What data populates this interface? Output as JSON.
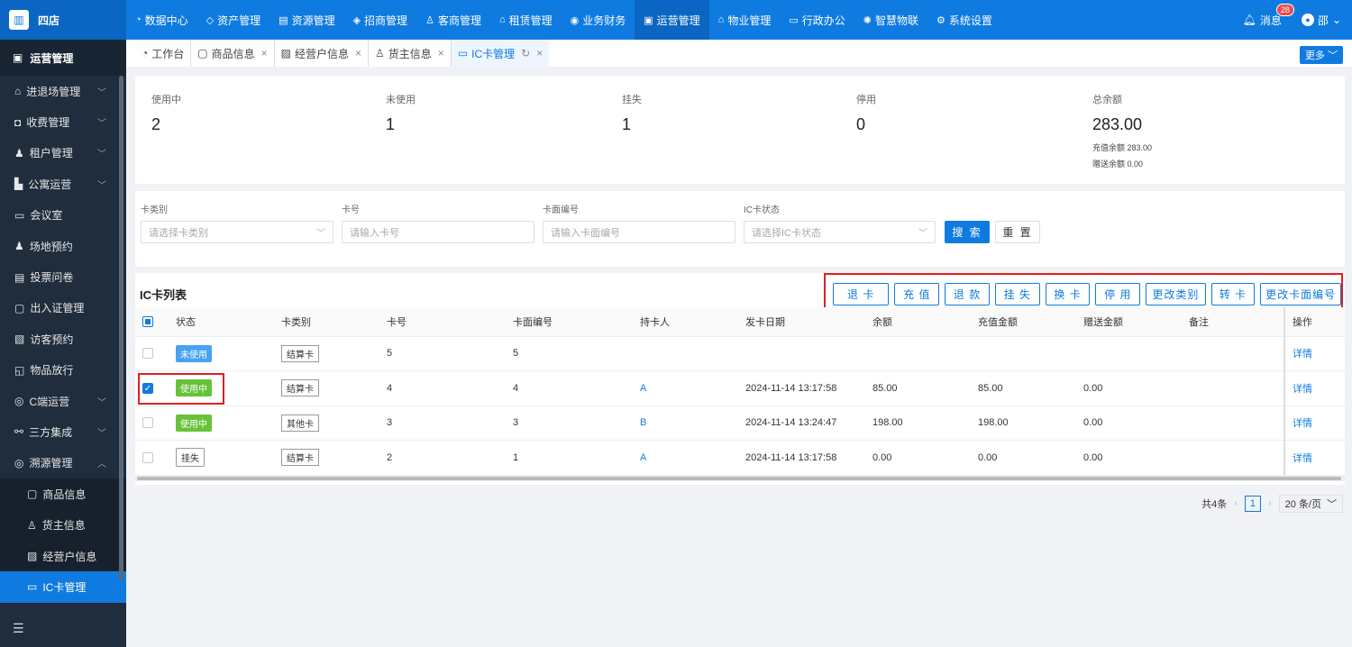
{
  "brand": {
    "logo_icon": "building-icon",
    "name": "四店"
  },
  "topnav": [
    {
      "label": "数据中心",
      "icon": "◔"
    },
    {
      "label": "资产管理",
      "icon": "◇"
    },
    {
      "label": "资源管理",
      "icon": "▤"
    },
    {
      "label": "招商管理",
      "icon": "◈"
    },
    {
      "label": "客商管理",
      "icon": "♙"
    },
    {
      "label": "租赁管理",
      "icon": "⌂"
    },
    {
      "label": "业务财务",
      "icon": "◉"
    },
    {
      "label": "运营管理",
      "icon": "▣"
    },
    {
      "label": "物业管理",
      "icon": "⌂"
    },
    {
      "label": "行政办公",
      "icon": "▭"
    },
    {
      "label": "智慧物联",
      "icon": "✺"
    },
    {
      "label": "系统设置",
      "icon": "⚙"
    }
  ],
  "top_right": {
    "message_label": "消息",
    "message_count": "28",
    "user_name": "邵"
  },
  "sidebar": {
    "header": "运营管理",
    "items": [
      {
        "label": "进退场管理",
        "icon": "⌂",
        "chev": "﹀"
      },
      {
        "label": "收费管理",
        "icon": "◘",
        "chev": "﹀"
      },
      {
        "label": "租户管理",
        "icon": "♟",
        "chev": "﹀"
      },
      {
        "label": "公寓运营",
        "icon": "▙",
        "chev": "﹀"
      },
      {
        "label": "会议室",
        "icon": "▭",
        "chev": ""
      },
      {
        "label": "场地预约",
        "icon": "♟",
        "chev": ""
      },
      {
        "label": "投票问卷",
        "icon": "▤",
        "chev": ""
      },
      {
        "label": "出入证管理",
        "icon": "▢",
        "chev": ""
      },
      {
        "label": "访客预约",
        "icon": "▧",
        "chev": ""
      },
      {
        "label": "物品放行",
        "icon": "◱",
        "chev": ""
      },
      {
        "label": "C端运营",
        "icon": "◎",
        "chev": "﹀"
      },
      {
        "label": "三方集成",
        "icon": "⚯",
        "chev": "﹀"
      },
      {
        "label": "溯源管理",
        "icon": "◎",
        "chev": "︿"
      }
    ],
    "sub_items": [
      {
        "label": "商品信息",
        "icon": "▢"
      },
      {
        "label": "货主信息",
        "icon": "♙"
      },
      {
        "label": "经营户信息",
        "icon": "▨"
      },
      {
        "label": "IC卡管理",
        "icon": "▭"
      }
    ],
    "collapse_icon": "☰"
  },
  "tabs": [
    {
      "label": "工作台",
      "icon": "◔"
    },
    {
      "label": "商品信息",
      "icon": "▢"
    },
    {
      "label": "经营户信息",
      "icon": "▨"
    },
    {
      "label": "货主信息",
      "icon": "♙"
    },
    {
      "label": "IC卡管理",
      "icon": "▭"
    }
  ],
  "more_label": "更多 ﹀",
  "stats": {
    "in_use": {
      "label": "使用中",
      "value": "2"
    },
    "unused": {
      "label": "未使用",
      "value": "1"
    },
    "lost": {
      "label": "挂失",
      "value": "1"
    },
    "disabled": {
      "label": "停用",
      "value": "0"
    },
    "total": {
      "label": "总余额",
      "value": "283.00",
      "recharge": "充值余额 283.00",
      "gift": "赠送余额 0.00"
    }
  },
  "filter": {
    "card_type": {
      "label": "卡类别",
      "placeholder": "请选择卡类别"
    },
    "card_no": {
      "label": "卡号",
      "placeholder": "请输入卡号"
    },
    "face_no": {
      "label": "卡面编号",
      "placeholder": "请输入卡面编号"
    },
    "status": {
      "label": "IC卡状态",
      "placeholder": "请选择IC卡状态"
    },
    "search": "搜 索",
    "reset": "重 置"
  },
  "list": {
    "title": "IC卡列表",
    "actions": [
      "退 卡",
      "充 值",
      "退 款",
      "挂 失",
      "换 卡",
      "停 用",
      "更改类别",
      "转 卡",
      "更改卡面编号"
    ],
    "columns": [
      "状态",
      "卡类别",
      "卡号",
      "卡面编号",
      "持卡人",
      "发卡日期",
      "余额",
      "充值金额",
      "赠送金额",
      "备注",
      "操作"
    ],
    "rows": [
      {
        "status": "未使用",
        "type": "结算卡",
        "no": "5",
        "face": "5",
        "holder": "",
        "date": "",
        "balance": "",
        "recharge": "",
        "gift": "",
        "note": "",
        "op": "详情"
      },
      {
        "status": "使用中",
        "type": "结算卡",
        "no": "4",
        "face": "4",
        "holder": "A",
        "date": "2024-11-14 13:17:58",
        "balance": "85.00",
        "recharge": "85.00",
        "gift": "0.00",
        "note": "",
        "op": "详情"
      },
      {
        "status": "使用中",
        "type": "其他卡",
        "no": "3",
        "face": "3",
        "holder": "B",
        "date": "2024-11-14 13:24:47",
        "balance": "198.00",
        "recharge": "198.00",
        "gift": "0.00",
        "note": "",
        "op": "详情"
      },
      {
        "status": "挂失",
        "type": "结算卡",
        "no": "2",
        "face": "1",
        "holder": "A",
        "date": "2024-11-14 13:17:58",
        "balance": "0.00",
        "recharge": "0.00",
        "gift": "0.00",
        "note": "",
        "op": "详情"
      }
    ]
  },
  "pager": {
    "total": "共4条",
    "page": "1",
    "size": "20 条/页"
  },
  "colors": {
    "primary": "#0f7be0",
    "sidebar": "#1f2d3d",
    "highlight": "#e02020"
  }
}
